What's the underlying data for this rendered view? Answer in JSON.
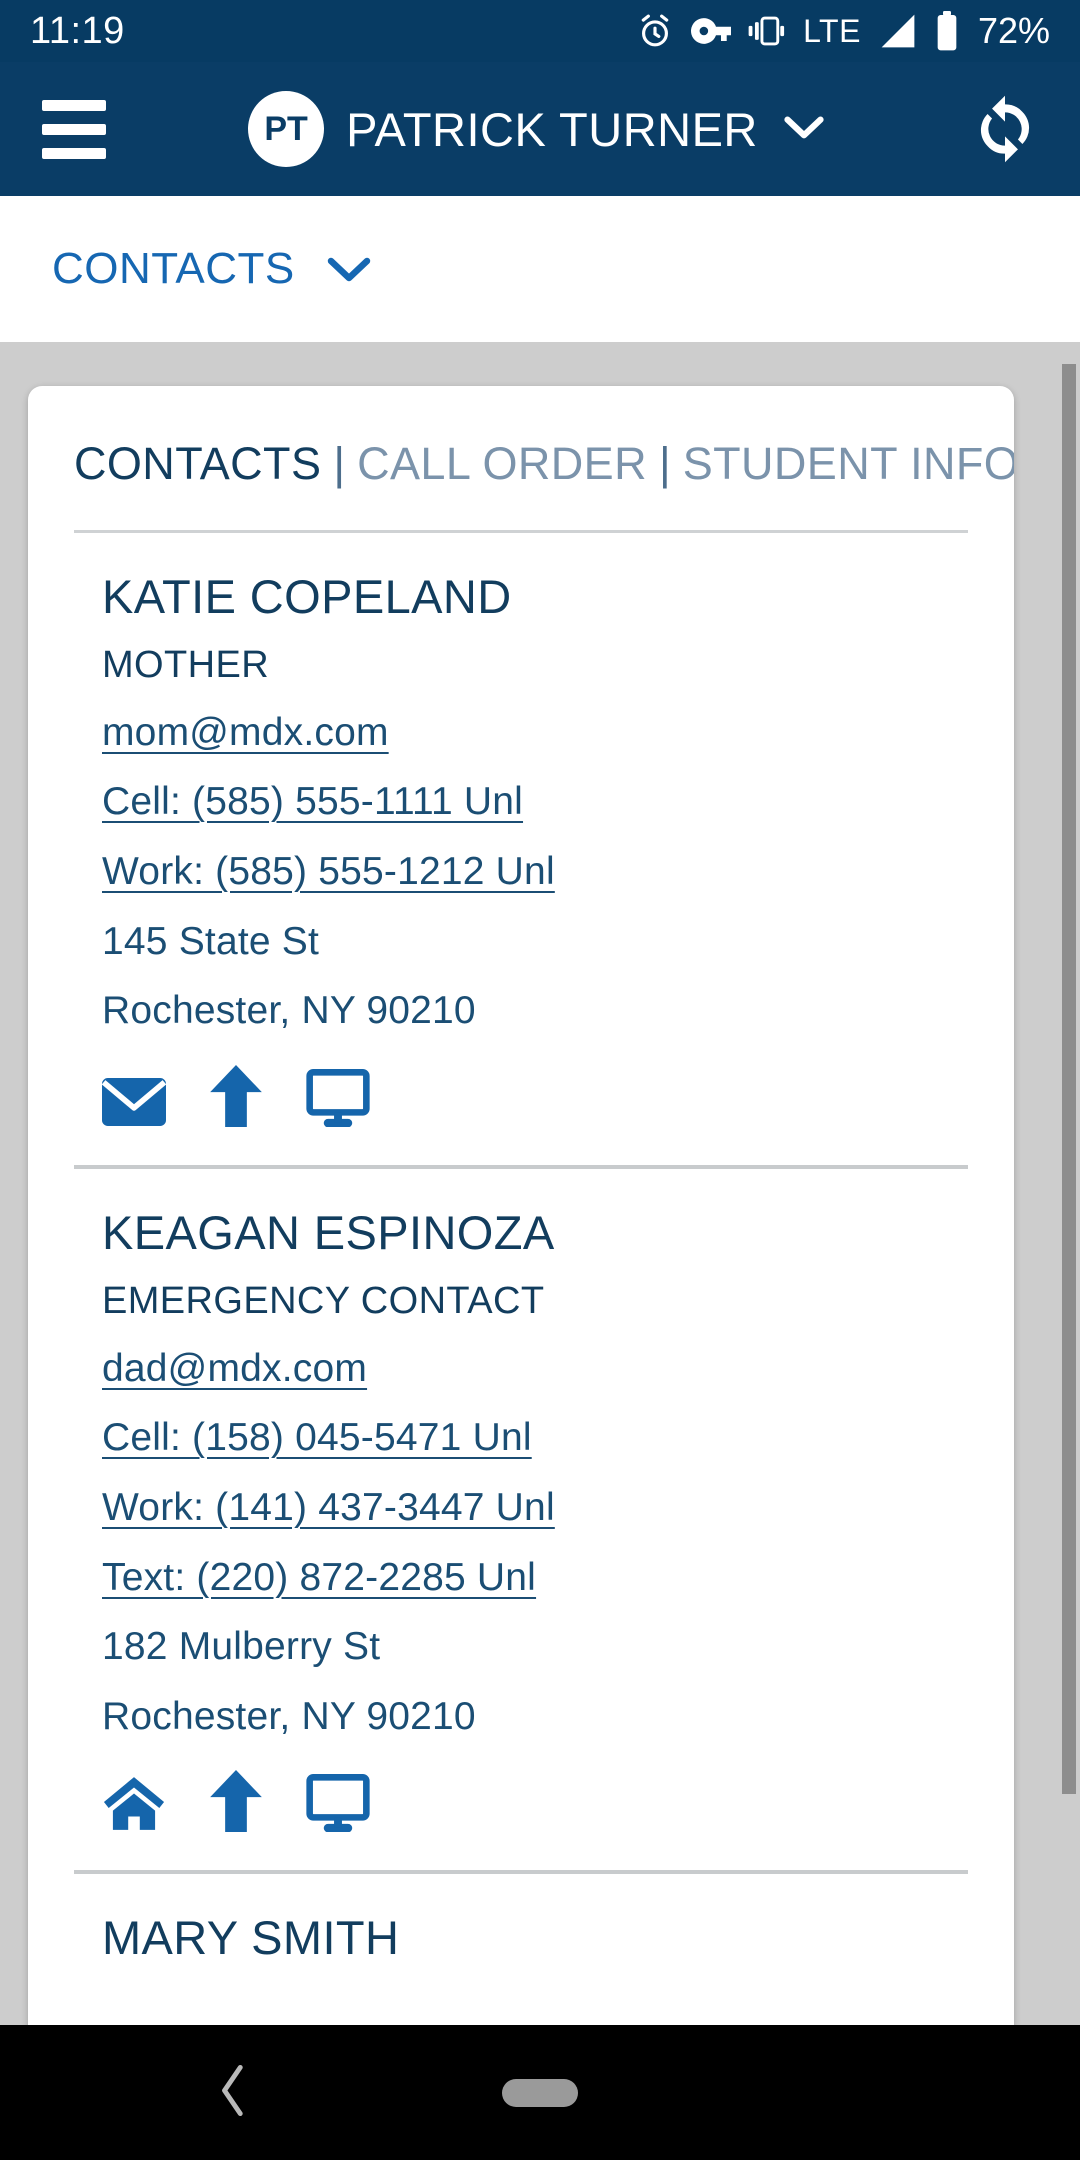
{
  "status_bar": {
    "time": "11:19",
    "network": "LTE",
    "battery": "72%",
    "icons": [
      "alarm-icon",
      "vpn-key-icon",
      "vibrate-icon",
      "signal-icon",
      "battery-icon"
    ]
  },
  "app_bar": {
    "menu_icon": "hamburger-menu-icon",
    "avatar_initials": "PT",
    "user_name": "PATRICK TURNER",
    "dropdown_icon": "chevron-down-icon",
    "refresh_icon": "refresh-icon"
  },
  "breadcrumb": {
    "label": "CONTACTS",
    "chevron_icon": "chevron-down-icon"
  },
  "card": {
    "tabs": [
      {
        "label": "CONTACTS",
        "active": true
      },
      {
        "label": "CALL ORDER",
        "active": false
      },
      {
        "label": "STUDENT INFO",
        "active": false
      }
    ],
    "tab_separator": "|",
    "contacts": [
      {
        "name": "KATIE COPELAND",
        "relationship": "MOTHER",
        "email": "mom@mdx.com",
        "phones": [
          "Cell: (585) 555-1111 Unl",
          "Work: (585) 555-1212 Unl"
        ],
        "address_line1": "145 State St",
        "address_line2": "Rochester, NY 90210",
        "actions": [
          "envelope-icon",
          "arrow-up-icon",
          "monitor-icon"
        ]
      },
      {
        "name": "KEAGAN ESPINOZA",
        "relationship": "EMERGENCY CONTACT",
        "email": "dad@mdx.com",
        "phones": [
          "Cell: (158) 045-5471 Unl",
          "Work: (141) 437-3447 Unl",
          "Text: (220) 872-2285 Unl"
        ],
        "address_line1": "182 Mulberry St",
        "address_line2": "Rochester, NY 90210",
        "actions": [
          "home-icon",
          "arrow-up-icon",
          "monitor-icon"
        ]
      },
      {
        "name": "MARY SMITH",
        "relationship": "",
        "email": "",
        "phones": [],
        "address_line1": "",
        "address_line2": "",
        "actions": []
      }
    ]
  },
  "nav_bar": {
    "back_icon": "chevron-left-icon",
    "home_icon": "home-pill-icon"
  },
  "colors": {
    "status_bar_bg": "#073b63",
    "app_bar_bg": "#0a3d66",
    "page_bg": "#cdcdcd",
    "card_bg": "#ffffff",
    "accent_link": "#1667b2",
    "text_navy": "#123d5e",
    "text_muted": "#7b93ab",
    "icon_blue": "#1565ab",
    "nav_bar_bg": "#000000"
  }
}
